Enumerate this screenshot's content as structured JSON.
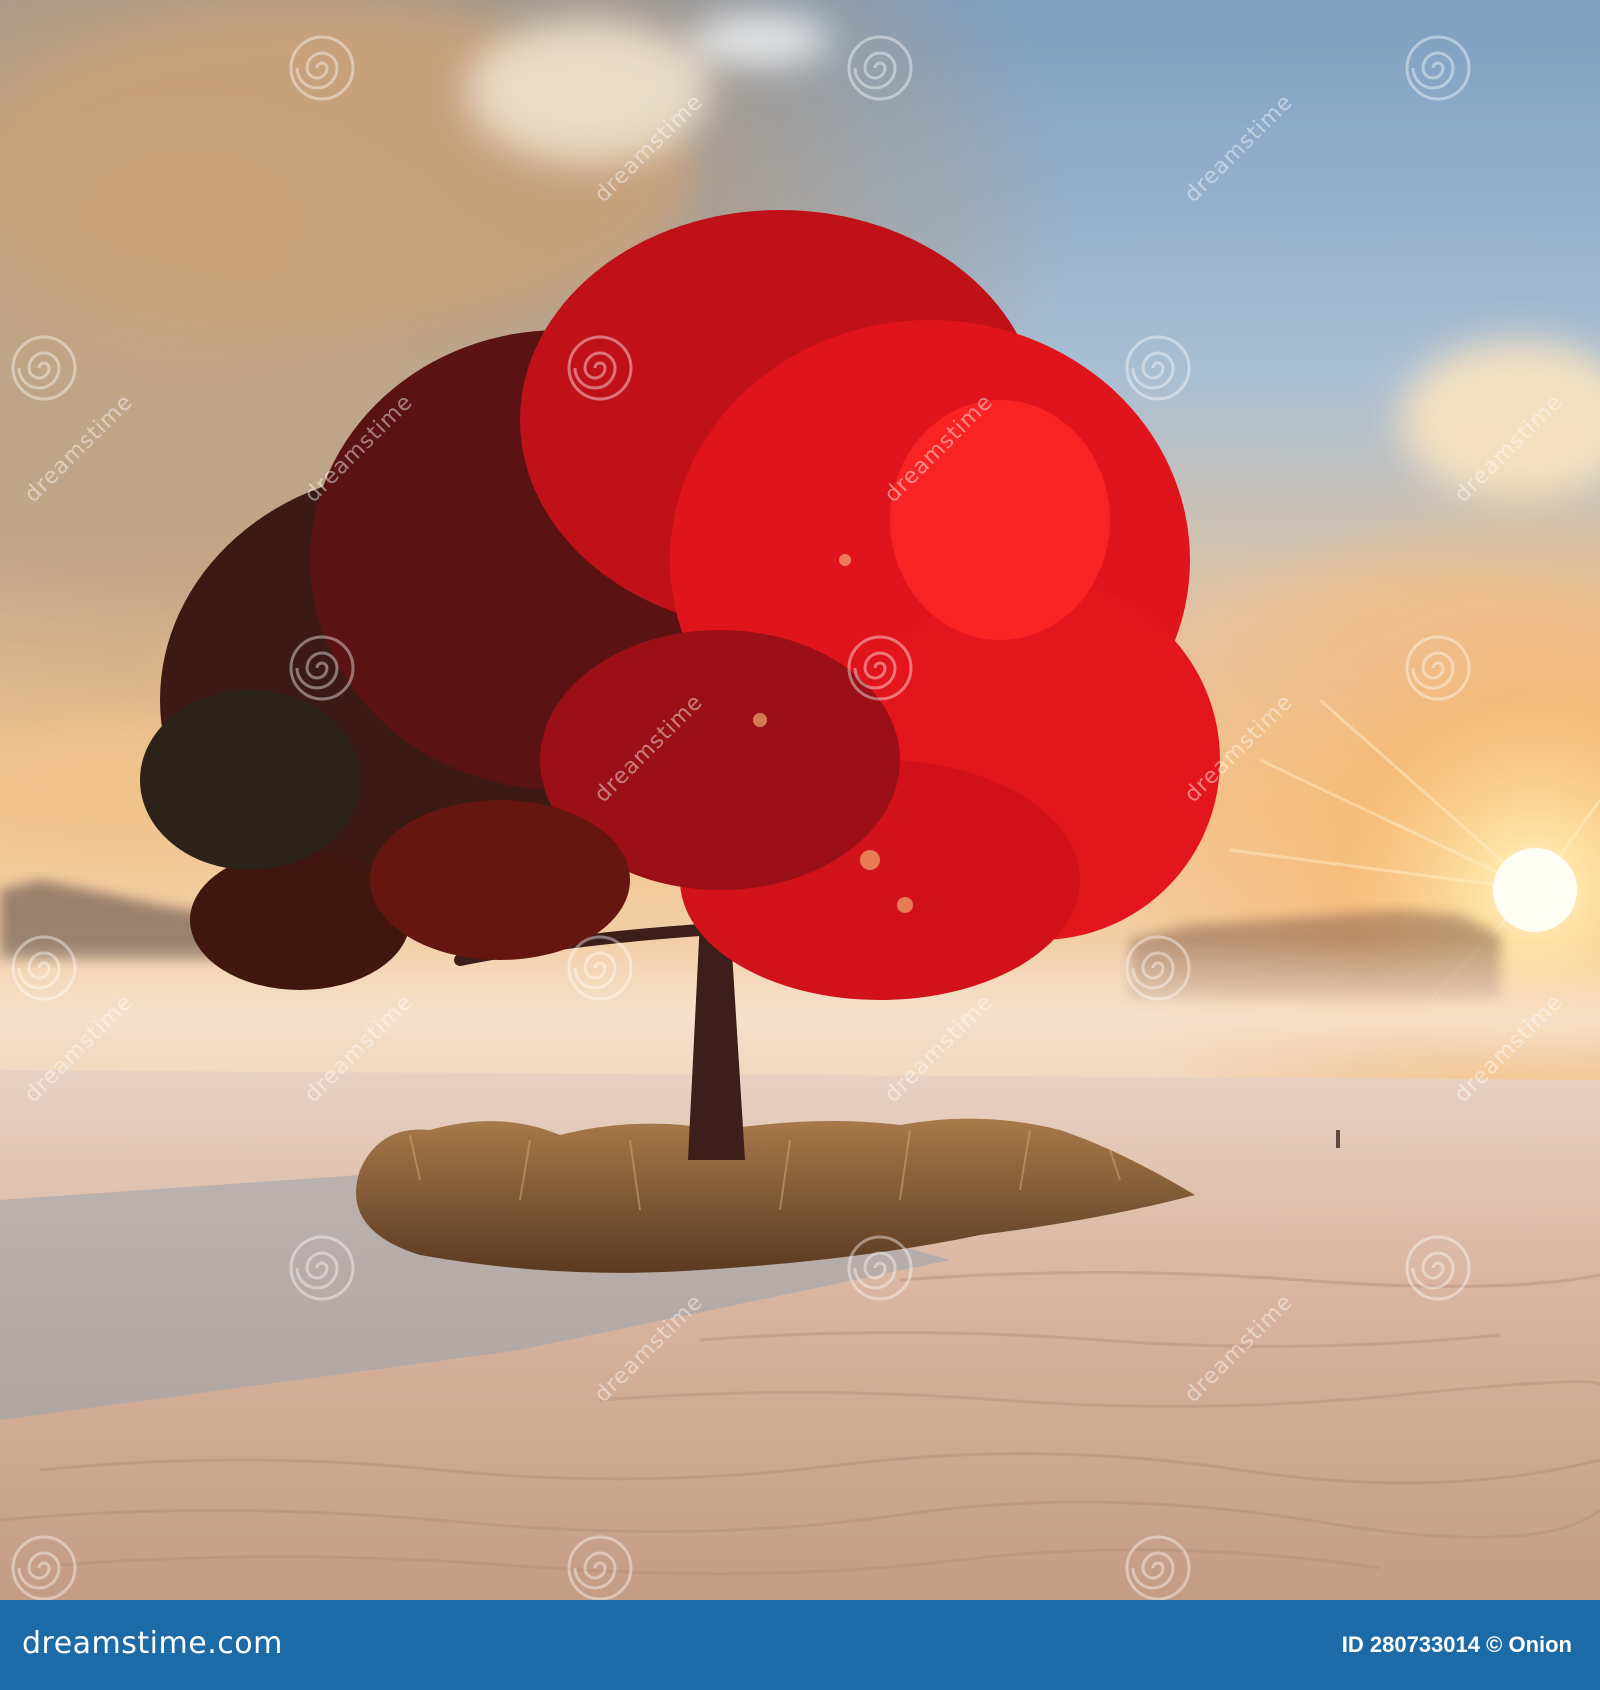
{
  "watermark": {
    "text": "dreamstime",
    "icon": "dreamstime-spiral-icon"
  },
  "footer": {
    "brand": "dreamstime.com",
    "image_id": "ID 280733014",
    "copyright_symbol": "©",
    "author": "Onion",
    "background_color": "#1c6aa6"
  },
  "scene": {
    "subject": "red-tree",
    "colors": {
      "foliage": "#d4111c",
      "sky_blue": "#8fb3d4",
      "sun": "#fff6d6",
      "sand": "#c9a48c"
    }
  }
}
